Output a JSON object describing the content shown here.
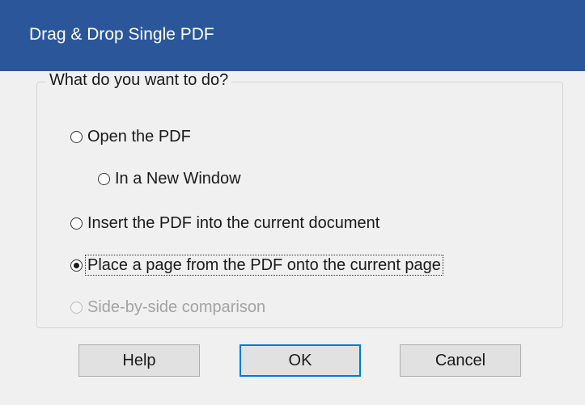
{
  "dialog": {
    "title": "Drag & Drop Single PDF"
  },
  "group": {
    "legend": "What do you want to do?",
    "options": [
      {
        "label": "Open the PDF",
        "checked": false,
        "enabled": true
      },
      {
        "label": "In a New Window",
        "checked": false,
        "enabled": true
      },
      {
        "label": "Insert the PDF into the current document",
        "checked": false,
        "enabled": true
      },
      {
        "label": "Place a page from the PDF onto the current page",
        "checked": true,
        "enabled": true
      },
      {
        "label": "Side-by-side comparison",
        "checked": false,
        "enabled": false
      }
    ]
  },
  "buttons": {
    "help": "Help",
    "ok": "OK",
    "cancel": "Cancel"
  },
  "colors": {
    "title_bar": "#2b579a",
    "default_button_border": "#0078d7"
  }
}
